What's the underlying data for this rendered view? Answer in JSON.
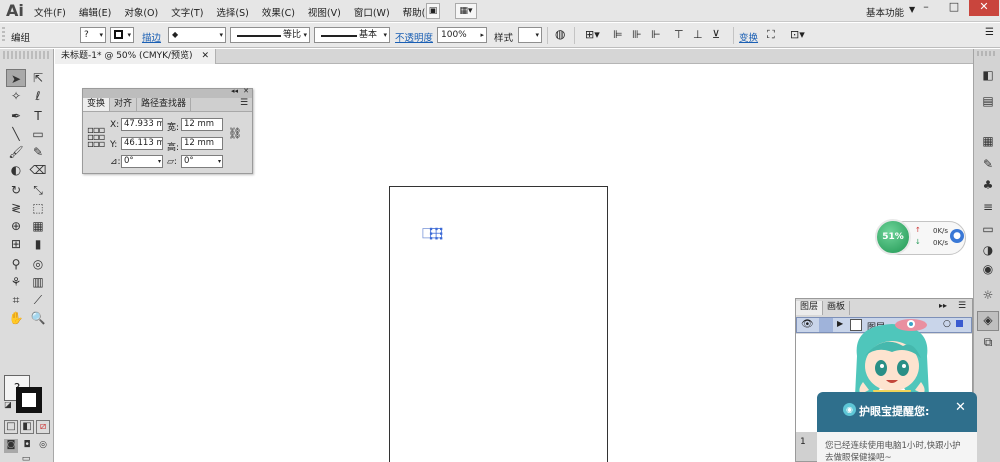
{
  "app": {
    "logo": "Ai",
    "menus": [
      "文件(F)",
      "编辑(E)",
      "对象(O)",
      "文字(T)",
      "选择(S)",
      "效果(C)",
      "视图(V)",
      "窗口(W)",
      "帮助(H)"
    ],
    "workspace_label": "基本功能",
    "window_buttons": {
      "minimize": "–",
      "restore": "□",
      "close": "✕"
    }
  },
  "control_bar": {
    "selection_label": "编组",
    "fill_value": "?",
    "stroke_link": "描边",
    "stroke_profile": "等比",
    "brush_label": "基本",
    "opacity_link": "不透明度",
    "opacity_value": "100%",
    "style_label": "样式",
    "transform_link": "变换"
  },
  "document": {
    "tab_title": "未标题-1* @ 50% (CMYK/预览)",
    "tab_close": "✕"
  },
  "transform_panel": {
    "tabs": [
      "变换",
      "对齐",
      "路径查找器"
    ],
    "x_label": "X:",
    "x_value": "47.933 m",
    "y_label": "Y:",
    "y_value": "46.113 m",
    "w_label": "宽:",
    "w_value": "12 mm",
    "h_label": "高:",
    "h_value": "12 mm",
    "rotate_value": "0°",
    "shear_value": "0°"
  },
  "toolbar": {
    "fill_swatch_text": "?"
  },
  "speed_widget": {
    "percent": "51%",
    "up_speed": "0K/s",
    "down_speed": "0K/s"
  },
  "layers_panel": {
    "tabs": [
      "图层",
      "画板"
    ],
    "layer_name": "图层",
    "footer_count": "1"
  },
  "popup": {
    "title": "护眼宝提醒您:",
    "close": "✕",
    "line1": "您已经连续使用电脑1小时,快跟小护",
    "line2": "去做眼保健操吧~"
  }
}
